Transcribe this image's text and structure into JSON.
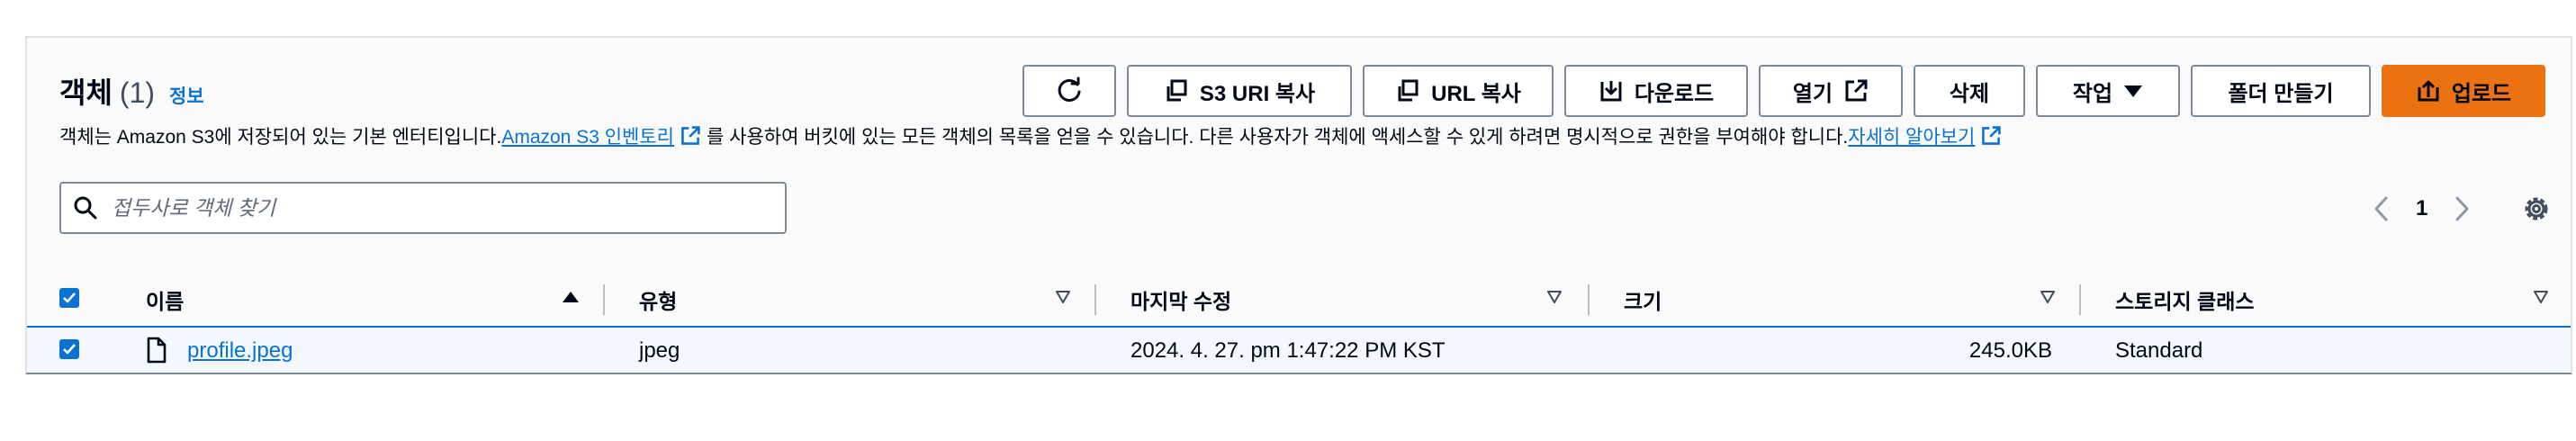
{
  "header": {
    "title": "객체",
    "count": "(1)",
    "info_link": "정보"
  },
  "description": {
    "part1": "객체는 Amazon S3에 저장되어 있는 기본 엔터티입니다. ",
    "inventory_link": "Amazon S3 인벤토리",
    "part2": "를 사용하여 버킷에 있는 모든 객체의 목록을 얻을 수 있습니다. 다른 사용자가 객체에 액세스할 수 있게 하려면 명시적으로 권한을 부여해야 합니다. ",
    "learn_more_link": "자세히 알아보기"
  },
  "toolbar": {
    "refresh_icon": "refresh-icon",
    "copy_s3_uri": "S3 URI 복사",
    "copy_url": "URL 복사",
    "download": "다운로드",
    "open": "열기",
    "delete": "삭제",
    "actions": "작업",
    "create_folder": "폴더 만들기",
    "upload": "업로드"
  },
  "search": {
    "placeholder": "접두사로 객체 찾기"
  },
  "pagination": {
    "current_page": "1"
  },
  "table": {
    "columns": [
      "이름",
      "유형",
      "마지막 수정",
      "크기",
      "스토리지 클래스"
    ],
    "rows": [
      {
        "name": "profile.jpeg",
        "type": "jpeg",
        "last_modified": "2024. 4. 27. pm 1:47:22 PM KST",
        "size": "245.0KB",
        "storage_class": "Standard"
      }
    ]
  },
  "colors": {
    "accent": "#0972d3",
    "primary_button": "#ec7211",
    "border": "#7d8998"
  }
}
